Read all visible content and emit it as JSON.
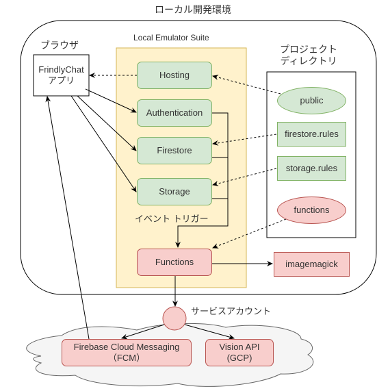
{
  "title": "ローカル開発環境",
  "browser": {
    "label": "ブラウザ",
    "app_line1": "FrindlyChat",
    "app_line2": "アプリ"
  },
  "emulator": {
    "label": "Local Emulator Suite",
    "services": {
      "hosting": "Hosting",
      "authentication": "Authentication",
      "firestore": "Firestore",
      "storage": "Storage",
      "functions": "Functions"
    },
    "trigger_label": "イベント トリガー"
  },
  "project": {
    "label_line1": "プロジェクト",
    "label_line2": "ディレクトリ",
    "items": {
      "public": "public",
      "firestore_rules": "firestore.rules",
      "storage_rules": "storage.rules",
      "functions": "functions"
    }
  },
  "imagemagick": "imagemagick",
  "service_account": "サービスアカウント",
  "cloud": {
    "fcm_line1": "Firebase Cloud Messaging",
    "fcm_line2": "（FCM）",
    "vision_line1": "Vision API",
    "vision_line2": "(GCP)"
  },
  "colors": {
    "green_fill": "#d5e8d4",
    "green_stroke": "#82b366",
    "red_fill": "#f8cecc",
    "red_stroke": "#b85450",
    "suite_fill": "#fff2cc",
    "suite_stroke": "#d6b656",
    "cloud_fill": "#f5f5f5"
  }
}
